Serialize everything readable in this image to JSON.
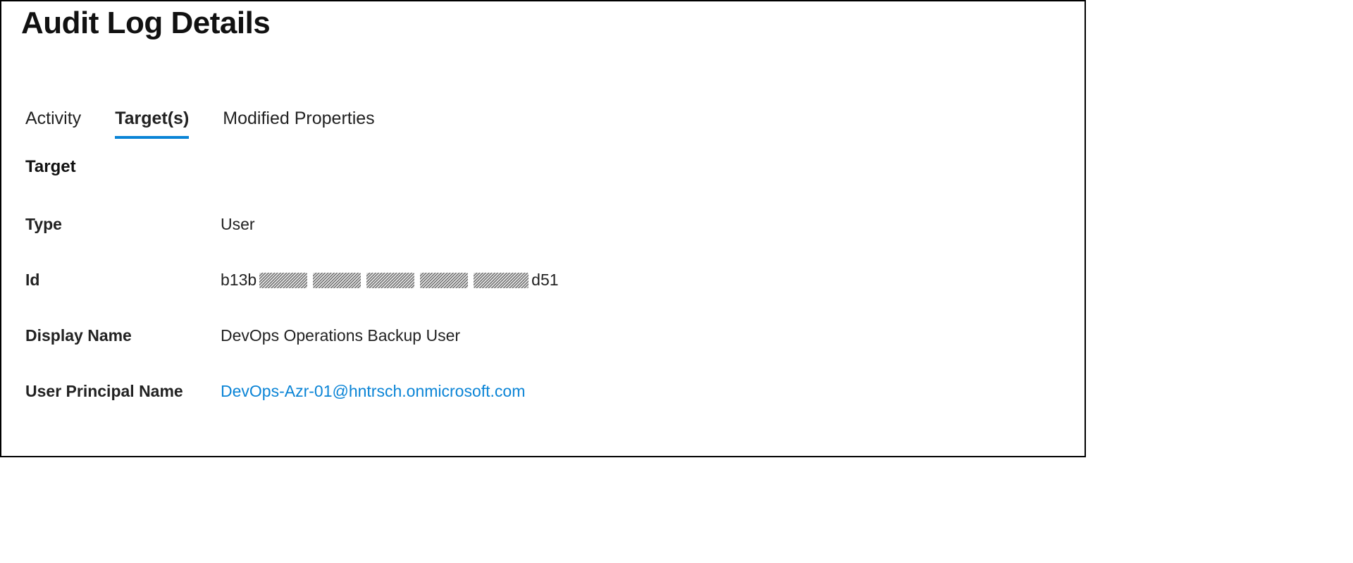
{
  "page_title": "Audit Log Details",
  "tabs": {
    "activity": "Activity",
    "targets": "Target(s)",
    "modified_properties": "Modified Properties",
    "active": "targets"
  },
  "section_heading": "Target",
  "details": {
    "type_label": "Type",
    "type_value": "User",
    "id_label": "Id",
    "id_prefix": "b13b",
    "id_suffix": "d51",
    "display_name_label": "Display Name",
    "display_name_value": "DevOps Operations Backup User",
    "upn_label": "User Principal Name",
    "upn_value": "DevOps-Azr-01@hntrsch.onmicrosoft.com"
  }
}
